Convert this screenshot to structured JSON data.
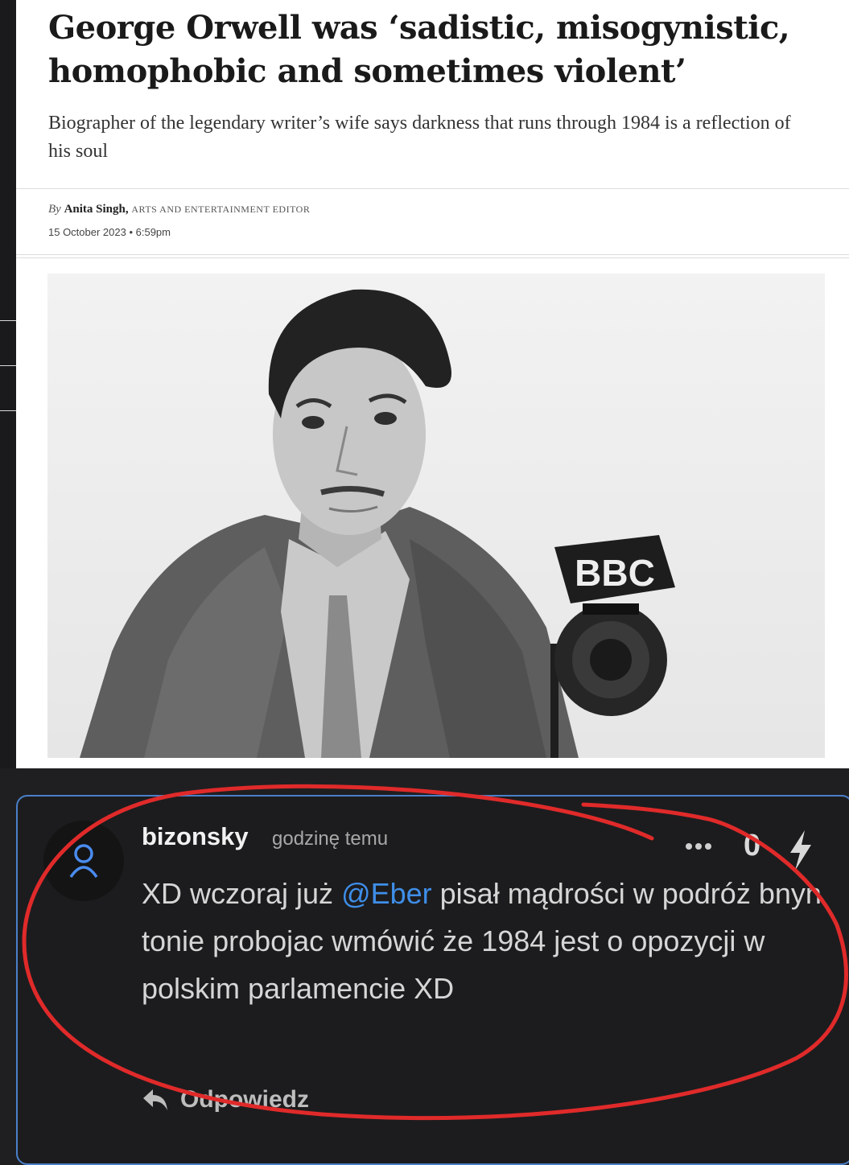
{
  "article": {
    "headline": "George Orwell was ‘sadistic, misogynistic, homophobic and sometimes violent’",
    "standfirst": "Biographer of the legendary writer’s wife says darkness that runs through 1984 is a reflection of his soul",
    "byline_prefix": "By",
    "author": "Anita Singh,",
    "author_role": "ARTS AND ENTERTAINMENT EDITOR",
    "date": "15 October 2023 • 6:59pm",
    "photo_mic_label": "BBC"
  },
  "comment": {
    "username": "bizonsky",
    "time_ago": "godzinę temu",
    "score": "0",
    "text_before": "XD wczoraj już ",
    "mention": "@Eber",
    "text_after": " pisał mądrości w podróż bnyn tonie probojac wmówić że 1984 jest o opozycji w polskim parlamencie XD",
    "reply_label": "Odpowiedz",
    "more_icon": "ellipsis-icon",
    "vote_icon": "lightning-bolt-icon",
    "avatar_icon": "user-icon"
  },
  "colors": {
    "mention": "#3f8ee8",
    "comment_bg": "#1c1c1e",
    "box_border": "#4a7fc9",
    "annotation": "#e02a2a"
  }
}
